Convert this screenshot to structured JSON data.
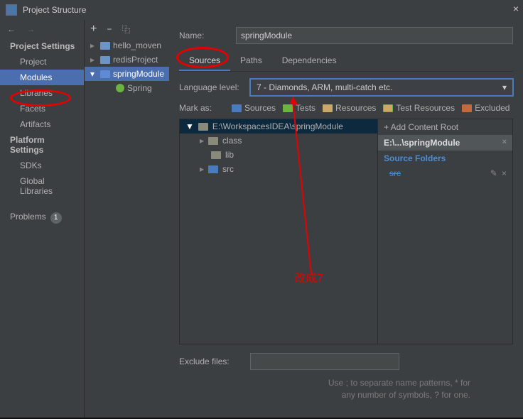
{
  "title": "Project Structure",
  "nav": {
    "h1": "Project Settings",
    "items1": [
      "Project",
      "Modules",
      "Libraries",
      "Facets",
      "Artifacts"
    ],
    "h2": "Platform Settings",
    "items2": [
      "SDKs",
      "Global Libraries"
    ],
    "problems": "Problems",
    "badge": "1"
  },
  "tree": {
    "items": [
      {
        "arrow": "▸",
        "label": "hello_moven"
      },
      {
        "arrow": "▸",
        "label": "redisProject"
      },
      {
        "arrow": "▾",
        "label": "springModule",
        "sel": true
      },
      {
        "arrow": "",
        "label": "Spring",
        "leaf": true,
        "indent": true
      }
    ]
  },
  "main": {
    "nameLbl": "Name:",
    "nameVal": "springModule",
    "tabs": [
      "Sources",
      "Paths",
      "Dependencies"
    ],
    "langLbl": "Language level:",
    "langVal": "7 - Diamonds, ARM, multi-catch etc.",
    "markLbl": "Mark as:",
    "marks": [
      "Sources",
      "Tests",
      "Resources",
      "Test Resources",
      "Excluded"
    ],
    "rootPath": "E:\\WorkspacesIDEA\\springModule",
    "children": [
      "class",
      "lib",
      "src"
    ],
    "addRoot": "+ Add Content Root",
    "sidePath": "E:\\...\\springModule",
    "srcFoldersLbl": "Source Folders",
    "srcFolder": "src",
    "excludeLbl": "Exclude files:",
    "hint1": "Use ; to separate name patterns, * for",
    "hint2": "any number of symbols, ? for one.",
    "annotation": "改成7"
  }
}
